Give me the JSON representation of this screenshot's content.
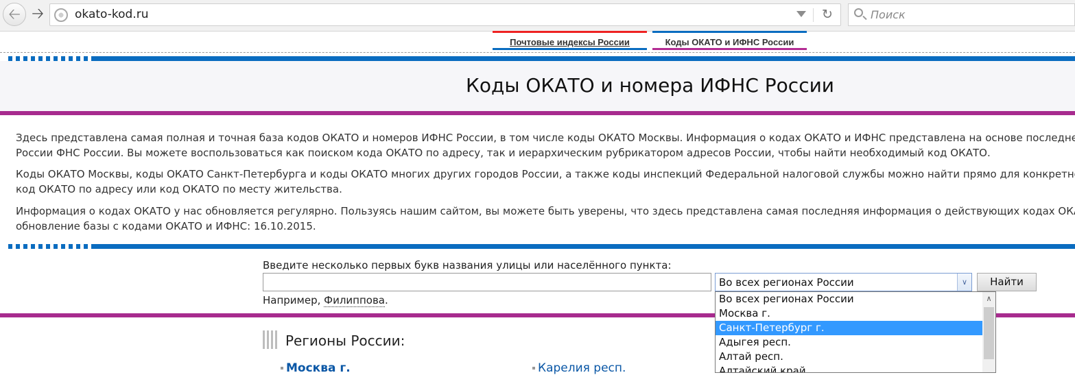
{
  "browser": {
    "url": "okato-kod.ru",
    "search_placeholder": "Поиск"
  },
  "nav": {
    "tabs": [
      {
        "label": "Почтовые индексы России"
      },
      {
        "label": "Коды ОКАТО и ИФНС России"
      }
    ]
  },
  "page": {
    "title": "Коды ОКАТО и номера ИФНС России",
    "paragraphs": [
      {
        "line1": "Здесь представлена самая полная и точная база кодов ОКАТО и номеров ИФНС России, в том числе коды ОКАТО Москвы. Информация о кодах ОКАТО и ИФНС представлена на основе последней ве",
        "line2": "России ФНС России. Вы можете воспользоваться как поиском кода ОКАТО по адресу, так и иерархическим рубрикатором адресов России, чтобы найти необходимый код ОКАТО."
      },
      {
        "line1": "Коды ОКАТО Москвы, коды ОКАТО Санкт-Петербурга и коды ОКАТО многих других городов России, а также коды инспекций Федеральной налоговой службы можно найти прямо для конкретного д",
        "line2": "код ОКАТО по адресу или код ОКАТО по месту жительства."
      },
      {
        "line1": "Информация о кодах ОКАТО у нас обновляется регулярно. Пользуясь нашим сайтом, вы можете быть уверены, что здесь представлена самая последняя информация о действующих кодах ОКАТО",
        "line2": "обновление базы с кодами ОКАТО и ИФНС: 16.10.2015."
      }
    ]
  },
  "search": {
    "label": "Введите несколько первых букв названия улицы или населённого пункта:",
    "input_value": "",
    "region_selected": "Во всех регионах России",
    "button": "Найти",
    "example_prefix": "Например, ",
    "example_link": "Филиппова",
    "example_suffix": "."
  },
  "dropdown": {
    "options": [
      "Во всех регионах России",
      "Москва г.",
      "Санкт-Петербург г.",
      "Адыгея респ.",
      "Алтай респ.",
      "Алтайский край"
    ],
    "highlighted_index": 2
  },
  "regions": {
    "title": "Регионы России:",
    "col1_first": "Москва г.",
    "col2_first": "Карелия респ."
  },
  "colors": {
    "accent_blue": "#0a6cc0",
    "accent_purple": "#a72b8e",
    "accent_red": "#e22222",
    "link": "#0a57a6",
    "highlight": "#3399ff"
  }
}
